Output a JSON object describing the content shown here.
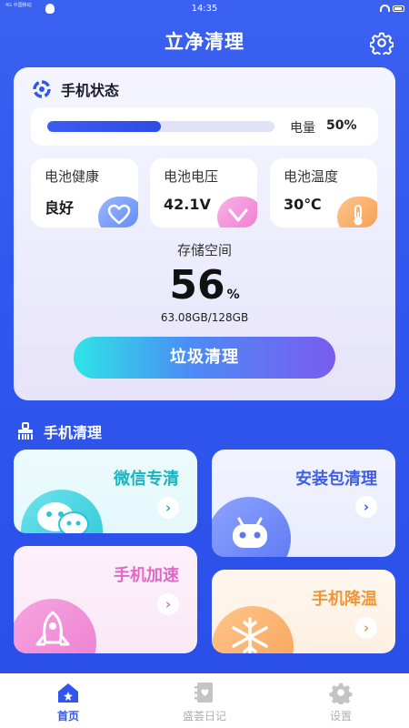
{
  "status_bar": {
    "time": "14:35",
    "signal_text": "4G 中国移动"
  },
  "header": {
    "title": "立净清理"
  },
  "phone_status": {
    "title": "手机状态",
    "battery": {
      "label": "电量",
      "value": "50%",
      "level": 0.5
    },
    "metrics": [
      {
        "label": "电池健康",
        "value": "良好",
        "icon": "heart-icon",
        "color": "#5b86f5"
      },
      {
        "label": "电池电压",
        "value": "42.1V",
        "icon": "chevron-down-icon",
        "color": "#ef74cf"
      },
      {
        "label": "电池温度",
        "value": "30℃",
        "icon": "thermometer-icon",
        "color": "#f49a4c"
      }
    ],
    "storage": {
      "label": "存储空间",
      "percent": "56",
      "percent_unit": "%",
      "detail": "63.08GB/128GB"
    },
    "clean_button": "垃圾清理"
  },
  "cleaning": {
    "title": "手机清理",
    "tools": [
      {
        "title": "微信专清",
        "icon": "wechat-icon",
        "color": "#19b5c2"
      },
      {
        "title": "安装包清理",
        "icon": "android-icon",
        "color": "#3f5fe0"
      },
      {
        "title": "手机加速",
        "icon": "rocket-icon",
        "color": "#e268c6"
      },
      {
        "title": "手机降温",
        "icon": "snowflake-icon",
        "color": "#f0963a"
      }
    ],
    "arrow": "›"
  },
  "tabbar": {
    "items": [
      {
        "label": "首页",
        "icon": "home-icon",
        "active": true
      },
      {
        "label": "盛荟日记",
        "icon": "diary-icon",
        "active": false
      },
      {
        "label": "设置",
        "icon": "gear-icon",
        "active": false
      }
    ]
  },
  "colors": {
    "brand_blue": "#2f56ee",
    "tab_inactive": "#b0b0b0"
  }
}
